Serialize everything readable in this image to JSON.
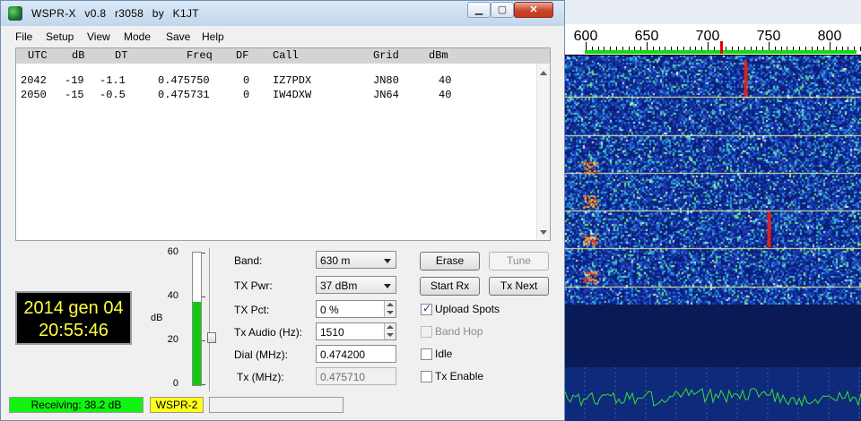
{
  "window": {
    "title": "WSPR-X   v0.8  r3058    by K1JT"
  },
  "menu": [
    "File",
    "Setup",
    "View",
    "Mode",
    "Save",
    "Help"
  ],
  "decode_table": {
    "columns": [
      "UTC",
      "dB",
      "DT",
      "Freq",
      "DF",
      "Call",
      "Grid",
      "dBm"
    ],
    "rows": [
      {
        "utc": "2042",
        "db": "-19",
        "dt": "-1.1",
        "freq": "0.475750",
        "df": "0",
        "call": "IZ7PDX",
        "grid": "JN80",
        "dbm": "40"
      },
      {
        "utc": "2050",
        "db": "-15",
        "dt": "-0.5",
        "freq": "0.475731",
        "df": "0",
        "call": "IW4DXW",
        "grid": "JN64",
        "dbm": "40"
      }
    ]
  },
  "clock": {
    "date": "2014 gen 04",
    "time": "20:55:46"
  },
  "meter": {
    "ticks": [
      "60",
      "40",
      "20",
      "0"
    ],
    "unit": "dB",
    "level_fraction": 0.63
  },
  "controls": {
    "band_label": "Band:",
    "band_value": "630 m",
    "txpwr_label": "TX Pwr:",
    "txpwr_value": "37 dBm",
    "txpct_label": "TX Pct:",
    "txpct_value": "0  %",
    "txaudio_label": "Tx Audio (Hz):",
    "txaudio_value": "1510",
    "dial_label": "Dial (MHz):",
    "dial_value": "0.474200",
    "tx_label": "Tx (MHz):",
    "tx_value": "0.475710"
  },
  "buttons": {
    "erase": "Erase",
    "tune": "Tune",
    "start_rx": "Start Rx",
    "tx_next": "Tx Next"
  },
  "checkboxes": [
    {
      "label": "Upload Spots",
      "checked": true,
      "enabled": true
    },
    {
      "label": "Band Hop",
      "checked": false,
      "enabled": false
    },
    {
      "label": "Idle",
      "checked": false,
      "enabled": true
    },
    {
      "label": "Tx Enable",
      "checked": false,
      "enabled": true
    }
  ],
  "status": {
    "receiving": "Receiving:  38.2 dB",
    "mode": "WSPR-2"
  },
  "waterfall": {
    "freq_labels": [
      "600",
      "650",
      "700",
      "750",
      "800"
    ]
  },
  "colors": {
    "receiving_bg": "#12f312",
    "mode_bg": "#ffff1a",
    "clock_fg": "#ffff3c",
    "clock_bg": "#000000",
    "meter_fill": "#14c814",
    "waterfall_marker": "#e40000"
  }
}
